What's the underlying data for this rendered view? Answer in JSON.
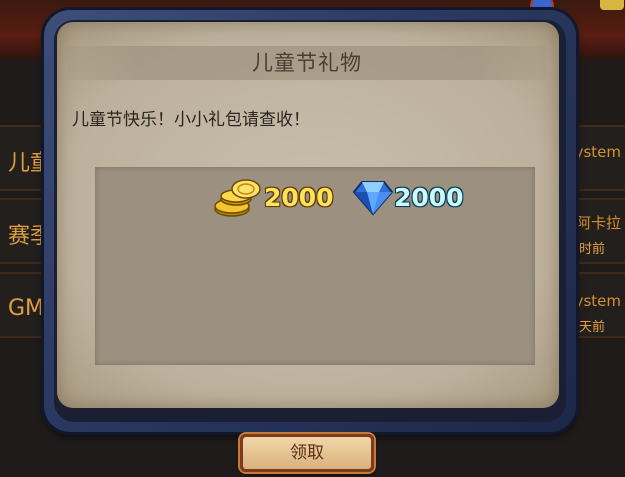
{
  "dialog": {
    "title": "儿童节礼物",
    "message": "儿童节快乐！小小礼包请查收！",
    "rewards": [
      {
        "icon": "gold-coins-icon",
        "amount": "2000"
      },
      {
        "icon": "diamond-icon",
        "amount": "2000"
      }
    ],
    "claim_label": "领取"
  },
  "background": {
    "rows": [
      {
        "left_label": "儿童",
        "right_label": "ystem",
        "right_time": ""
      },
      {
        "left_label": "赛季",
        "right_label": "阿卡拉",
        "right_time": "小时前"
      },
      {
        "left_label": "GM",
        "right_label": "ystem",
        "right_time": "天前"
      }
    ]
  },
  "colors": {
    "frame": "#2b3a62",
    "paper": "#c9bfae",
    "gold_text": "#ffe25a",
    "gem_text": "#c8fbff",
    "button": "#e6c792"
  }
}
